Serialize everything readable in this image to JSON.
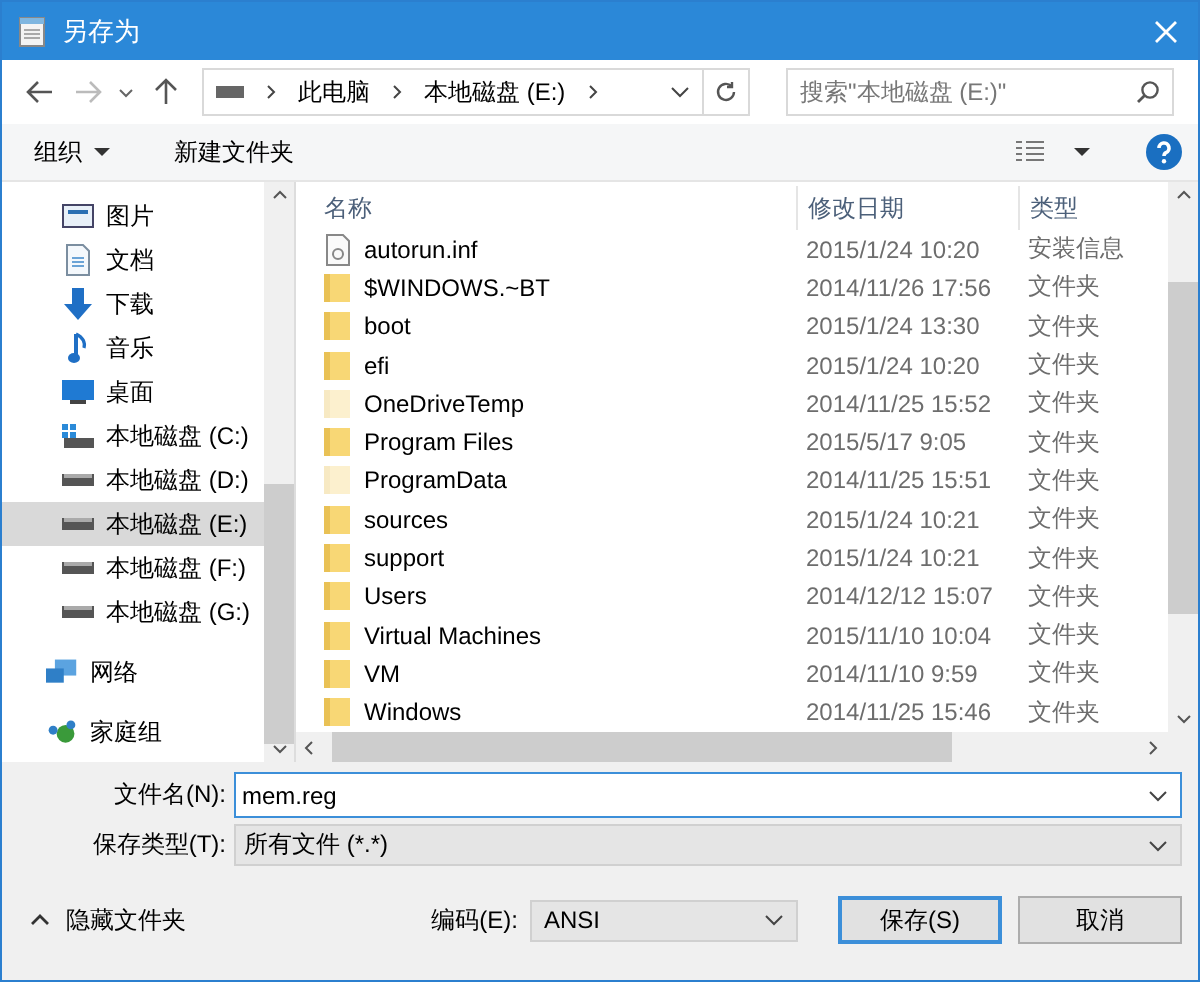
{
  "window": {
    "title": "另存为"
  },
  "address": {
    "crumbs": [
      "此电脑",
      "本地磁盘 (E:)"
    ]
  },
  "search": {
    "placeholder": "搜索\"本地磁盘 (E:)\""
  },
  "toolbar": {
    "organize": "组织",
    "new_folder": "新建文件夹"
  },
  "sidebar": {
    "items": [
      {
        "label": "图片",
        "kind": "pictures",
        "selected": false
      },
      {
        "label": "文档",
        "kind": "documents",
        "selected": false
      },
      {
        "label": "下载",
        "kind": "downloads",
        "selected": false
      },
      {
        "label": "音乐",
        "kind": "music",
        "selected": false
      },
      {
        "label": "桌面",
        "kind": "desktop",
        "selected": false
      },
      {
        "label": "本地磁盘 (C:)",
        "kind": "system-drive",
        "selected": false
      },
      {
        "label": "本地磁盘 (D:)",
        "kind": "drive",
        "selected": false
      },
      {
        "label": "本地磁盘 (E:)",
        "kind": "drive",
        "selected": true
      },
      {
        "label": "本地磁盘 (F:)",
        "kind": "drive",
        "selected": false
      },
      {
        "label": "本地磁盘 (G:)",
        "kind": "drive",
        "selected": false
      },
      {
        "label": "网络",
        "kind": "network",
        "selected": false
      },
      {
        "label": "家庭组",
        "kind": "homegroup",
        "selected": false
      }
    ]
  },
  "table": {
    "columns": [
      "名称",
      "修改日期",
      "类型"
    ],
    "rows": [
      {
        "name": "autorun.inf",
        "date": "2015/1/24 10:20",
        "type": "安装信息",
        "kind": "file",
        "hidden": false
      },
      {
        "name": "$WINDOWS.~BT",
        "date": "2014/11/26 17:56",
        "type": "文件夹",
        "kind": "folder",
        "hidden": false
      },
      {
        "name": "boot",
        "date": "2015/1/24 13:30",
        "type": "文件夹",
        "kind": "folder",
        "hidden": false
      },
      {
        "name": "efi",
        "date": "2015/1/24 10:20",
        "type": "文件夹",
        "kind": "folder",
        "hidden": false
      },
      {
        "name": "OneDriveTemp",
        "date": "2014/11/25 15:52",
        "type": "文件夹",
        "kind": "folder",
        "hidden": true
      },
      {
        "name": "Program Files",
        "date": "2015/5/17 9:05",
        "type": "文件夹",
        "kind": "folder",
        "hidden": false
      },
      {
        "name": "ProgramData",
        "date": "2014/11/25 15:51",
        "type": "文件夹",
        "kind": "folder",
        "hidden": true
      },
      {
        "name": "sources",
        "date": "2015/1/24 10:21",
        "type": "文件夹",
        "kind": "folder",
        "hidden": false
      },
      {
        "name": "support",
        "date": "2015/1/24 10:21",
        "type": "文件夹",
        "kind": "folder",
        "hidden": false
      },
      {
        "name": "Users",
        "date": "2014/12/12 15:07",
        "type": "文件夹",
        "kind": "folder",
        "hidden": false
      },
      {
        "name": "Virtual Machines",
        "date": "2015/11/10 10:04",
        "type": "文件夹",
        "kind": "folder",
        "hidden": false
      },
      {
        "name": "VM",
        "date": "2014/11/10 9:59",
        "type": "文件夹",
        "kind": "folder",
        "hidden": false
      },
      {
        "name": "Windows",
        "date": "2014/11/25 15:46",
        "type": "文件夹",
        "kind": "folder",
        "hidden": false
      }
    ]
  },
  "form": {
    "filename_label": "文件名(N):",
    "filename": "mem.reg",
    "type_label": "保存类型(T):",
    "type_value": "所有文件  (*.*)",
    "encoding_label": "编码(E):",
    "encoding": "ANSI"
  },
  "footer": {
    "hide_folders": "隐藏文件夹",
    "buttons": [
      "保存(S)",
      "取消"
    ]
  }
}
